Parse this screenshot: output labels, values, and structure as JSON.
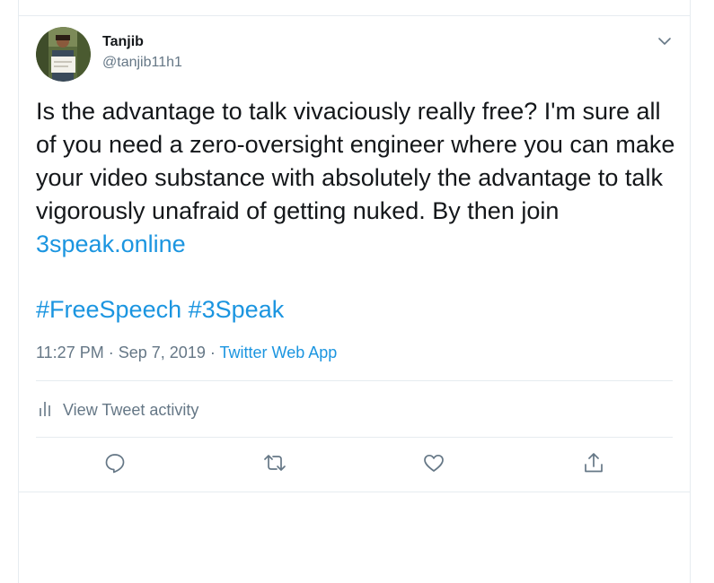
{
  "user": {
    "display_name": "Tanjib",
    "handle": "@tanjib11h1"
  },
  "tweet": {
    "text_part1": "Is the advantage to talk vivaciously really free? I'm sure all of you need a zero-oversight engineer where you can make your video substance with absolutely the advantage to talk vigorously unafraid of getting nuked. By then join ",
    "link": "3speak.online",
    "hashtag1": "#FreeSpeech",
    "hashtag2": "#3Speak"
  },
  "meta": {
    "time": "11:27 PM",
    "separator": "·",
    "date": "Sep 7, 2019",
    "source": "Twitter Web App"
  },
  "activity": {
    "label": "View Tweet activity"
  },
  "actions": [
    "reply-icon",
    "retweet-icon",
    "like-icon",
    "share-icon"
  ],
  "colors": {
    "link": "#1b95e0",
    "secondary_text": "#657786",
    "primary_text": "#14171a",
    "border": "#e6ecf0"
  }
}
